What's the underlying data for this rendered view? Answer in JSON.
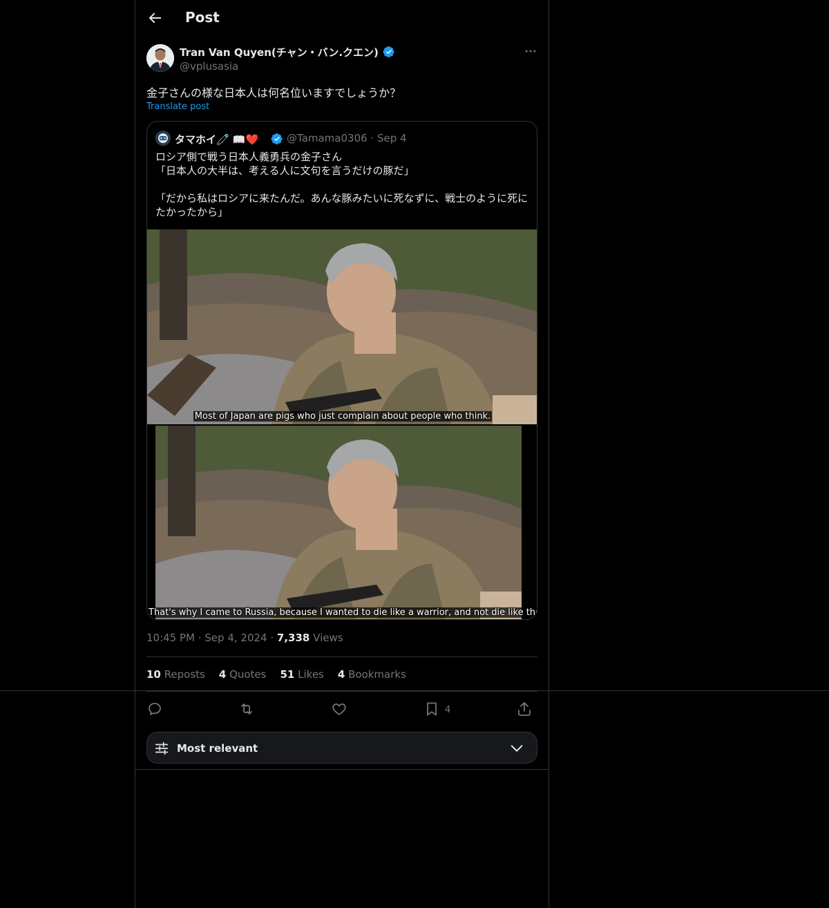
{
  "header": {
    "title": "Post"
  },
  "post": {
    "author": {
      "display_name": "Tran Van Quyen(チャン・バン.クエン)",
      "handle": "@vplusasia"
    },
    "text": "金子さんの様な日本人は何名位いますでしょうか？",
    "translate_label": "Translate post",
    "timestamp": "10:45 PM · Sep 4, 2024",
    "views_count": "7,338",
    "views_label": "Views",
    "stats": [
      {
        "count": "10",
        "label": "Reposts"
      },
      {
        "count": "4",
        "label": "Quotes"
      },
      {
        "count": "51",
        "label": "Likes"
      },
      {
        "count": "4",
        "label": "Bookmarks"
      }
    ],
    "bookmark_count": "4"
  },
  "quote": {
    "display_name": "タマホイ🧷 📖❤️",
    "handle": "@Tamama0306",
    "date": "Sep 4",
    "text": "ロシア側で戦う日本人義勇兵の金子さん\n「日本人の大半は、考える人に文句を言うだけの豚だ」\n\n「だから私はロシアに来たんだ。あんな豚みたいに死なずに、戦士のように死にたかったから」",
    "image1_caption": "Most of Japan are pigs who just complain about people who think.",
    "image2_caption": "That's why I came to Russia, because I wanted to die like a warrior, and not die like those pigs."
  },
  "sort": {
    "label": "Most relevant"
  },
  "colors": {
    "accent": "#1d9bf0",
    "text": "#e7e9ea",
    "muted": "#71767b",
    "border": "#2f3336",
    "background": "#000000"
  }
}
